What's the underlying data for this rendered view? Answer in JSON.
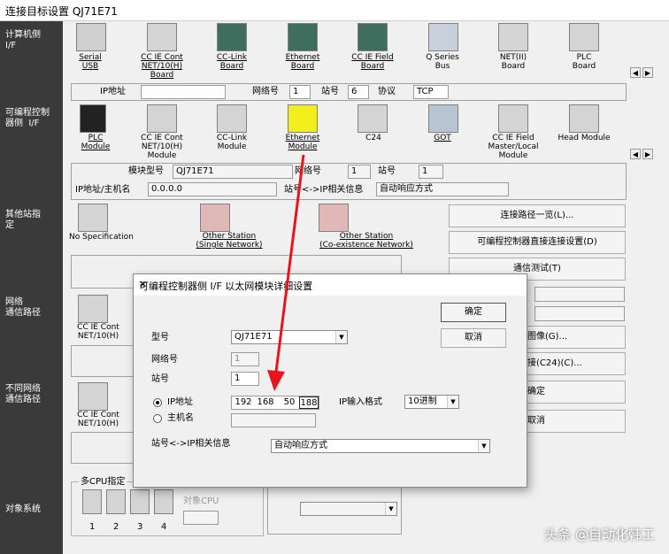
{
  "window": {
    "title": "连接目标设置 QJ71E71"
  },
  "sidebar": {
    "computer_if": "计算机侧\nI/F",
    "plc_if": "可编程控制\n器侧  I/F",
    "other_station": "其他站指\n定",
    "network_route": "网络\n通信路径",
    "diff_network": "不同网络\n通信路径",
    "target_system": "对象系统"
  },
  "pc_if": {
    "items": [
      {
        "label": "Serial\nUSB",
        "icon": "serial-usb-icon"
      },
      {
        "label": "CC IE Cont\nNET/10(H)\nBoard",
        "icon": "cc-ie-cont-board-icon"
      },
      {
        "label": "CC-Link\nBoard",
        "icon": "cc-link-board-icon"
      },
      {
        "label": "Ethernet\nBoard",
        "icon": "ethernet-board-icon"
      },
      {
        "label": "CC IE Field\nBoard",
        "icon": "cc-ie-field-board-icon"
      },
      {
        "label": "Q Series\nBus",
        "icon": "q-series-bus-icon"
      },
      {
        "label": "NET(II)\nBoard",
        "icon": "net-ii-board-icon"
      },
      {
        "label": "PLC\nBoard",
        "icon": "plc-board-icon"
      }
    ],
    "ip_label": "IP地址",
    "ip_value": "",
    "network_label": "网络号",
    "network_value": "1",
    "station_label": "站号",
    "station_value": "6",
    "protocol_label": "协议",
    "protocol_value": "TCP"
  },
  "plc_if": {
    "items": [
      {
        "label": "PLC\nModule",
        "icon": "plc-module-icon"
      },
      {
        "label": "CC IE Cont\nNET/10(H)\nModule",
        "icon": "cc-ie-cont-module-icon"
      },
      {
        "label": "CC-Link\nModule",
        "icon": "cc-link-module-icon"
      },
      {
        "label": "Ethernet\nModule",
        "icon": "ethernet-module-icon"
      },
      {
        "label": "C24",
        "icon": "c24-icon"
      },
      {
        "label": "GOT",
        "icon": "got-icon"
      },
      {
        "label": "CC IE Field\nMaster/Local\nModule",
        "icon": "cc-ie-field-master-icon"
      },
      {
        "label": "Head Module",
        "icon": "head-module-icon"
      }
    ],
    "model_label": "模块型号",
    "model_value": "QJ71E71",
    "network_label": "网络号",
    "network_value": "1",
    "station_label": "站号",
    "station_value": "1",
    "ip_host_label": "IP地址/主机名",
    "ip_host_value": "0.0.0.0",
    "station_ip_label": "站号<->IP相关信息",
    "station_ip_value": "自动响应方式"
  },
  "other_station": {
    "no_spec": "No Specification",
    "single": "Other Station\n(Single Network)",
    "coexist": "Other Station\n(Co-existence Network)"
  },
  "right_buttons": {
    "route_list": "连接路径一览(L)...",
    "direct_connect": "可编程控制器直接连接设置(D)",
    "comm_test": "通信测试(T)",
    "image": "图像(G)...",
    "c24_connect": "接(C24)(C)...",
    "ok": "确定",
    "cancel": "取消"
  },
  "network_route": {
    "item": "CC IE Cont\nNET/10(H)"
  },
  "diff_network": {
    "item": "CC IE Cont\nNET/10(H)"
  },
  "multi_cpu": {
    "label": "多CPU指定",
    "target_cpu": "对象CPU",
    "cpus": [
      "1",
      "2",
      "3",
      "4"
    ]
  },
  "dialog": {
    "title": "可编程控制器侧 I/F 以太网模块详细设置",
    "close": "✕",
    "ok": "确定",
    "cancel": "取消",
    "model_label": "型号",
    "model_value": "QJ71E71",
    "network_label": "网络号",
    "network_value": "1",
    "station_label": "站号",
    "station_value": "1",
    "ip_radio": "IP地址",
    "host_radio": "主机名",
    "ip": [
      "192",
      "168",
      "50",
      "188"
    ],
    "ip_format_label": "IP输入格式",
    "ip_format_value": "10进制",
    "station_ip_label": "站号<->IP相关信息",
    "station_ip_value": "自动响应方式"
  },
  "watermark": "头条 @自动化韩工",
  "colors": {
    "sidebar": "#3a3a3a",
    "arrow": "#e8141b",
    "selected_icon": "#f3ef1a"
  }
}
